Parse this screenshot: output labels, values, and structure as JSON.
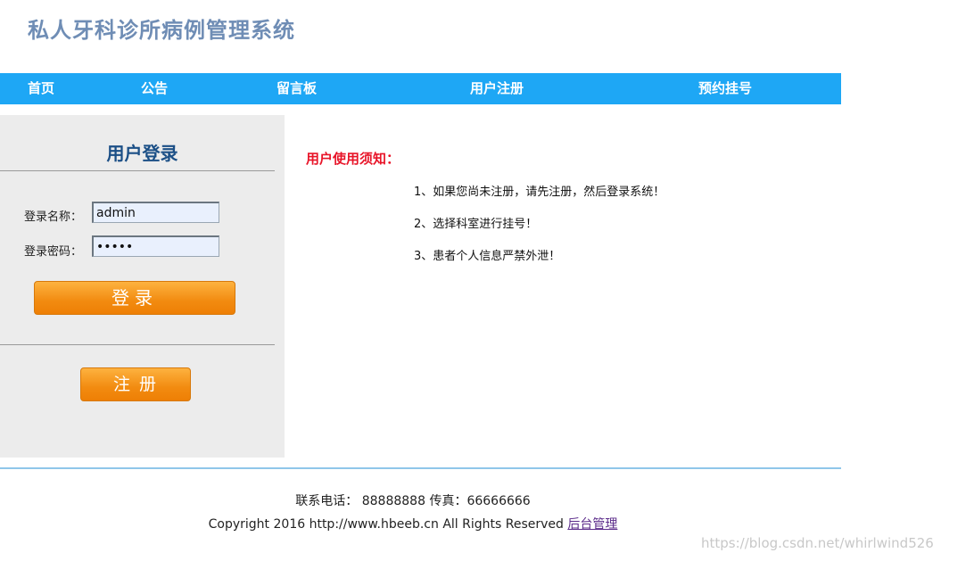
{
  "site": {
    "title": "私人牙科诊所病例管理系统"
  },
  "nav": {
    "items": [
      "首页",
      "公告",
      "留言板",
      "用户注册",
      "预约挂号"
    ]
  },
  "login": {
    "title": "用户登录",
    "username_label": "登录名称：",
    "username_value": "admin",
    "password_label": "登录密码：",
    "password_value": "admin",
    "login_button": "登录",
    "register_button": "注册"
  },
  "notice": {
    "title": "用户使用须知：",
    "items": [
      "1、如果您尚未注册，请先注册，然后登录系统！",
      "2、选择科室进行挂号！",
      "3、患者个人信息严禁外泄！"
    ]
  },
  "footer": {
    "contact": "联系电话： 88888888 传真：66666666",
    "copyright": "Copyright 2016 http://www.hbeeb.cn All Rights Reserved ",
    "admin_link": "后台管理"
  },
  "watermark": "https://blog.csdn.net/whirlwind526"
}
